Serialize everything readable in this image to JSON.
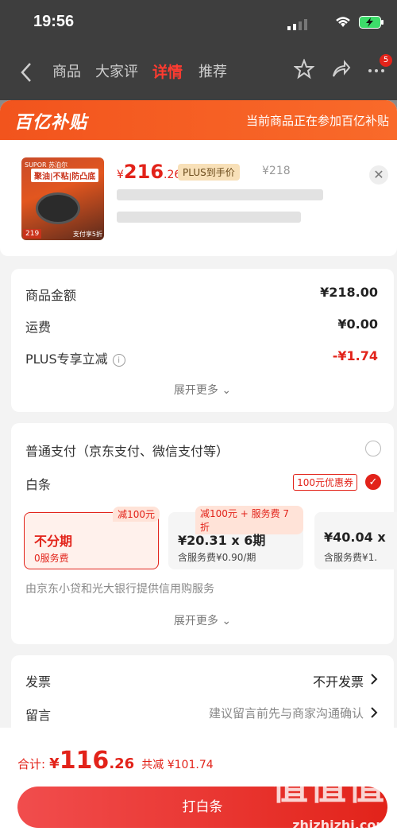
{
  "status": {
    "time": "19:56"
  },
  "nav": {
    "tabs": [
      {
        "label": "商品"
      },
      {
        "label": "大家评"
      },
      {
        "label": "详情"
      },
      {
        "label": "推荐"
      }
    ],
    "message_badge": "5"
  },
  "sheet": {
    "brand": "百亿补贴",
    "note": "当前商品正在参加百亿补贴"
  },
  "product": {
    "thumb_text1": "SUPOR 苏泊尔",
    "thumb_text2": "聚油|不粘|防凸底",
    "thumb_price": "219",
    "thumb_promo": "支付享5折",
    "price_currency": "¥",
    "price_int": "216",
    "price_dec": ".26",
    "plus_tag": "PLUS到手价",
    "original_price": "¥218"
  },
  "summary": {
    "rows": [
      {
        "label": "商品金额",
        "value": "¥218.00"
      },
      {
        "label": "运费",
        "value": "¥0.00"
      },
      {
        "label": "PLUS专享立减",
        "value": "-¥1.74"
      }
    ],
    "expand": "展开更多 ⌄"
  },
  "payment": {
    "normal": "普通支付（京东支付、微信支付等）",
    "baitiao": "白条",
    "coupon": "100元优惠券",
    "plans": [
      {
        "tag": "减100元",
        "title": "不分期",
        "sub": "0服务费"
      },
      {
        "tag": "减100元 + 服务费 7 折",
        "title": "¥20.31 x 6期",
        "sub": "含服务费¥0.90/期"
      },
      {
        "tag": "",
        "title": "¥40.04 x",
        "sub": "含服务费¥1."
      }
    ],
    "provider": "由京东小贷和光大银行提供信用购服务",
    "expand": "展开更多 ⌄"
  },
  "extra": {
    "invoice_label": "发票",
    "invoice_value": "不开发票",
    "message_label": "留言",
    "message_value": "建议留言前先与商家沟通确认"
  },
  "footer": {
    "total_label": "合计:",
    "currency": "¥",
    "total_int": "116",
    "total_dec": ".26",
    "saved": "共减 ¥101.74",
    "pay_button": "打白条"
  },
  "watermark": {
    "big": "值值值",
    "small": "zhizhizhi.com"
  },
  "colors": {
    "accent": "#e2231a",
    "header": "#f2541d"
  }
}
